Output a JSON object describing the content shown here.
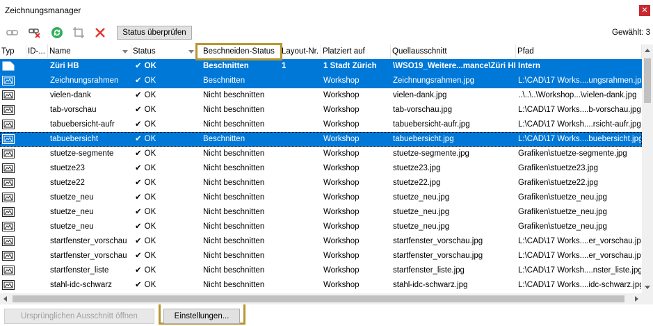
{
  "window": {
    "title": "Zeichnungsmanager",
    "close_glyph": "✕"
  },
  "toolbar": {
    "icons": [
      "link-icon",
      "unlink-icon",
      "refresh-icon",
      "crop-icon",
      "delete-icon"
    ],
    "status_button": "Status überprüfen",
    "selected_count": "Gewählt: 3"
  },
  "columns": [
    "Typ",
    "ID-...",
    "Name",
    "Status",
    "Beschneiden-Status",
    "Layout-Nr.",
    "Platziert auf",
    "Quellausschnitt",
    "Pfad"
  ],
  "check_glyph": "✔",
  "rows": [
    {
      "id": "",
      "name": "Züri HB",
      "status": "OK",
      "crop": "Beschnitten",
      "layout": "1",
      "placed": "1 Stadt Zürich",
      "source": "\\WSO19_Weitere...mance\\Züri HB",
      "path": "Intern",
      "selected": true,
      "kind": "drawing"
    },
    {
      "id": "",
      "name": "Zeichnungsrahmen",
      "status": "OK",
      "crop": "Beschnitten",
      "layout": "",
      "placed": "Workshop",
      "source": "Zeichnungsrahmen.jpg",
      "path": "L:\\CAD\\17 Works....ungsrahmen.jpg",
      "selected": true,
      "kind": "image"
    },
    {
      "id": "",
      "name": "vielen-dank",
      "status": "OK",
      "crop": "Nicht beschnitten",
      "layout": "",
      "placed": "Workshop",
      "source": "vielen-dank.jpg",
      "path": "..\\..\\..\\Workshop...\\vielen-dank.jpg",
      "selected": false,
      "kind": "image"
    },
    {
      "id": "",
      "name": "tab-vorschau",
      "status": "OK",
      "crop": "Nicht beschnitten",
      "layout": "",
      "placed": "Workshop",
      "source": "tab-vorschau.jpg",
      "path": "L:\\CAD\\17 Works....b-vorschau.jpg",
      "selected": false,
      "kind": "image"
    },
    {
      "id": "",
      "name": "tabuebersicht-aufr",
      "status": "OK",
      "crop": "Nicht beschnitten",
      "layout": "",
      "placed": "Workshop",
      "source": "tabuebersicht-aufr.jpg",
      "path": "L:\\CAD\\17 Worksh....rsicht-aufr.jpg",
      "selected": false,
      "kind": "image"
    },
    {
      "id": "",
      "name": "tabuebersicht",
      "status": "OK",
      "crop": "Beschnitten",
      "layout": "",
      "placed": "Workshop",
      "source": "tabuebersicht.jpg",
      "path": "L:\\CAD\\17 Works....buebersicht.jpg",
      "selected": true,
      "kind": "image",
      "focus": true
    },
    {
      "id": "",
      "name": "stuetze-segmente",
      "status": "OK",
      "crop": "Nicht beschnitten",
      "layout": "",
      "placed": "Workshop",
      "source": "stuetze-segmente.jpg",
      "path": "Grafiken\\stuetze-segmente.jpg",
      "selected": false,
      "kind": "image"
    },
    {
      "id": "",
      "name": "stuetze23",
      "status": "OK",
      "crop": "Nicht beschnitten",
      "layout": "",
      "placed": "Workshop",
      "source": "stuetze23.jpg",
      "path": "Grafiken\\stuetze23.jpg",
      "selected": false,
      "kind": "image"
    },
    {
      "id": "",
      "name": "stuetze22",
      "status": "OK",
      "crop": "Nicht beschnitten",
      "layout": "",
      "placed": "Workshop",
      "source": "stuetze22.jpg",
      "path": "Grafiken\\stuetze22.jpg",
      "selected": false,
      "kind": "image"
    },
    {
      "id": "",
      "name": "stuetze_neu",
      "status": "OK",
      "crop": "Nicht beschnitten",
      "layout": "",
      "placed": "Workshop",
      "source": "stuetze_neu.jpg",
      "path": "Grafiken\\stuetze_neu.jpg",
      "selected": false,
      "kind": "image"
    },
    {
      "id": "",
      "name": "stuetze_neu",
      "status": "OK",
      "crop": "Nicht beschnitten",
      "layout": "",
      "placed": "Workshop",
      "source": "stuetze_neu.jpg",
      "path": "Grafiken\\stuetze_neu.jpg",
      "selected": false,
      "kind": "image"
    },
    {
      "id": "",
      "name": "stuetze_neu",
      "status": "OK",
      "crop": "Nicht beschnitten",
      "layout": "",
      "placed": "Workshop",
      "source": "stuetze_neu.jpg",
      "path": "Grafiken\\stuetze_neu.jpg",
      "selected": false,
      "kind": "image"
    },
    {
      "id": "",
      "name": "startfenster_vorschau",
      "status": "OK",
      "crop": "Nicht beschnitten",
      "layout": "",
      "placed": "Workshop",
      "source": "startfenster_vorschau.jpg",
      "path": "L:\\CAD\\17 Works....er_vorschau.jpg",
      "selected": false,
      "kind": "image"
    },
    {
      "id": "",
      "name": "startfenster_vorschau",
      "status": "OK",
      "crop": "Nicht beschnitten",
      "layout": "",
      "placed": "Workshop",
      "source": "startfenster_vorschau.jpg",
      "path": "L:\\CAD\\17 Works....er_vorschau.jpg",
      "selected": false,
      "kind": "image"
    },
    {
      "id": "",
      "name": "startfenster_liste",
      "status": "OK",
      "crop": "Nicht beschnitten",
      "layout": "",
      "placed": "Workshop",
      "source": "startfenster_liste.jpg",
      "path": "L:\\CAD\\17 Worksh....nster_liste.jpg",
      "selected": false,
      "kind": "image"
    },
    {
      "id": "",
      "name": "stahl-idc-schwarz",
      "status": "OK",
      "crop": "Nicht beschnitten",
      "layout": "",
      "placed": "Workshop",
      "source": "stahl-idc-schwarz.jpg",
      "path": "L:\\CAD\\17 Works....idc-schwarz.jpg",
      "selected": false,
      "kind": "image"
    }
  ],
  "buttons": {
    "open_original": "Ursprünglichen Ausschnitt öffnen",
    "settings": "Einstellungen..."
  },
  "colors": {
    "selection": "#0078d7",
    "highlight": "#b8952e",
    "ok_check": "#2b2b2b"
  }
}
